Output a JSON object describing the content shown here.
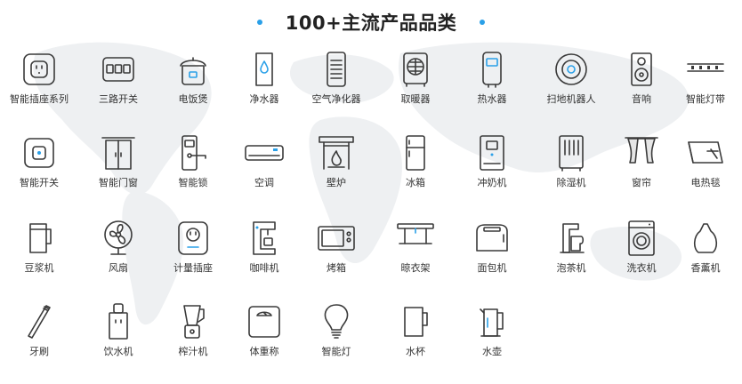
{
  "header": {
    "title": "100+主流产品品类"
  },
  "accent_color": "#2aa0e8",
  "categories": [
    {
      "label": "智能插座系列",
      "icon": "smart-socket-icon"
    },
    {
      "label": "三路开关",
      "icon": "three-way-switch-icon"
    },
    {
      "label": "电饭煲",
      "icon": "rice-cooker-icon"
    },
    {
      "label": "净水器",
      "icon": "water-purifier-icon"
    },
    {
      "label": "空气净化器",
      "icon": "air-purifier-icon"
    },
    {
      "label": "取暖器",
      "icon": "heater-icon"
    },
    {
      "label": "热水器",
      "icon": "water-heater-icon"
    },
    {
      "label": "扫地机器人",
      "icon": "robot-vacuum-icon"
    },
    {
      "label": "音响",
      "icon": "speaker-icon"
    },
    {
      "label": "智能灯带",
      "icon": "light-strip-icon"
    },
    {
      "label": "智能开关",
      "icon": "smart-switch-icon"
    },
    {
      "label": "智能门窗",
      "icon": "smart-door-icon"
    },
    {
      "label": "智能锁",
      "icon": "smart-lock-icon"
    },
    {
      "label": "空调",
      "icon": "air-conditioner-icon"
    },
    {
      "label": "壁炉",
      "icon": "fireplace-icon"
    },
    {
      "label": "冰箱",
      "icon": "fridge-icon"
    },
    {
      "label": "冲奶机",
      "icon": "formula-maker-icon"
    },
    {
      "label": "除湿机",
      "icon": "dehumidifier-icon"
    },
    {
      "label": "窗帘",
      "icon": "curtain-icon"
    },
    {
      "label": "电热毯",
      "icon": "electric-blanket-icon"
    },
    {
      "label": "豆浆机",
      "icon": "soymilk-maker-icon"
    },
    {
      "label": "风扇",
      "icon": "fan-icon"
    },
    {
      "label": "计量插座",
      "icon": "metering-socket-icon"
    },
    {
      "label": "咖啡机",
      "icon": "coffee-machine-icon"
    },
    {
      "label": "烤箱",
      "icon": "oven-icon"
    },
    {
      "label": "晾衣架",
      "icon": "clothes-rack-icon"
    },
    {
      "label": "面包机",
      "icon": "toaster-icon"
    },
    {
      "label": "泡茶机",
      "icon": "tea-maker-icon"
    },
    {
      "label": "洗衣机",
      "icon": "washing-machine-icon"
    },
    {
      "label": "香薰机",
      "icon": "aroma-diffuser-icon"
    },
    {
      "label": "牙刷",
      "icon": "toothbrush-icon"
    },
    {
      "label": "饮水机",
      "icon": "water-dispenser-icon"
    },
    {
      "label": "榨汁机",
      "icon": "juicer-icon"
    },
    {
      "label": "体重称",
      "icon": "scale-icon"
    },
    {
      "label": "智能灯",
      "icon": "smart-bulb-icon"
    },
    {
      "label": "水杯",
      "icon": "cup-icon"
    },
    {
      "label": "水壶",
      "icon": "kettle-icon"
    }
  ]
}
